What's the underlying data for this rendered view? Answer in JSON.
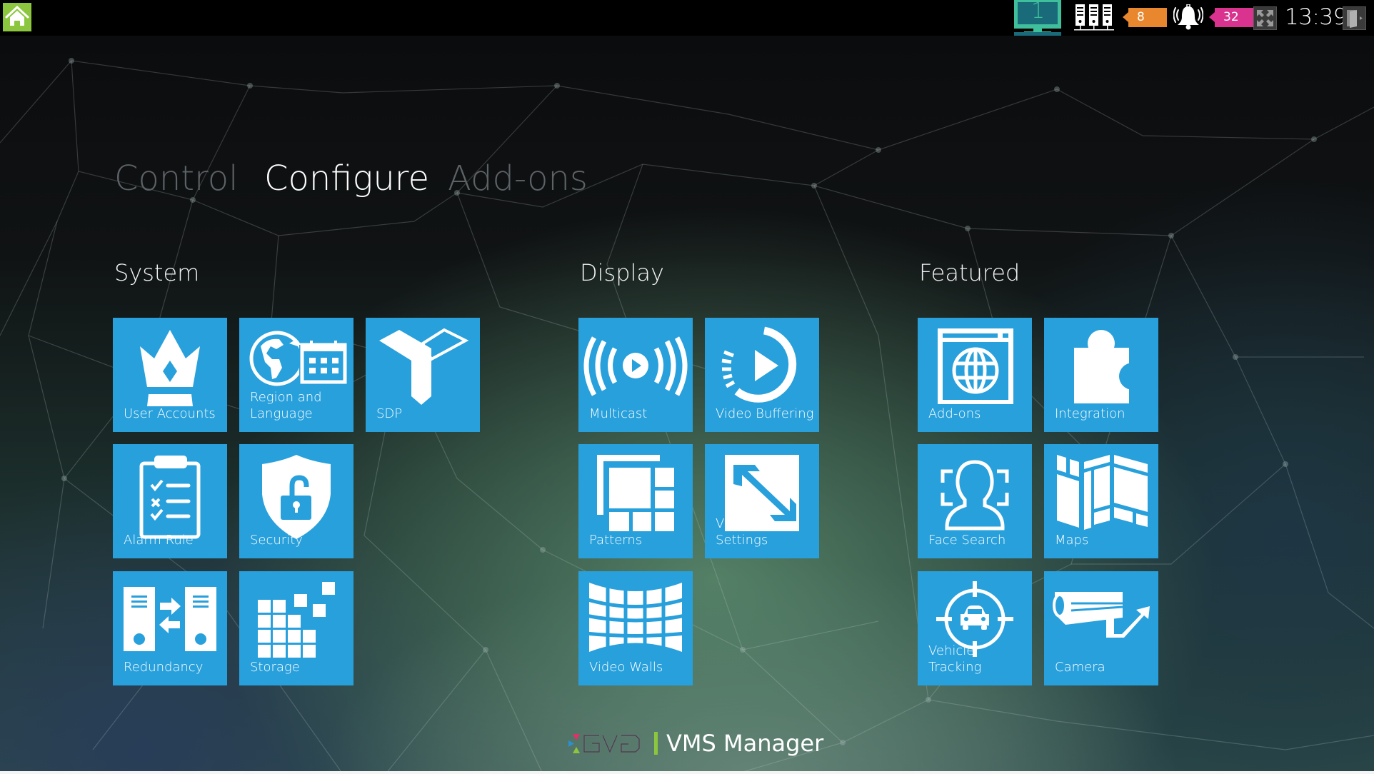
{
  "topbar": {
    "home_icon": "home-icon",
    "monitor_number": "1",
    "server_count": "8",
    "alarm_count": "32",
    "time": "13:39",
    "colors": {
      "home": "#8cc63f",
      "monitor": "#3fbf9b",
      "server_badge": "#e8872d",
      "alarm_badge": "#d9338f"
    }
  },
  "tabs": [
    {
      "label": "Control",
      "active": false
    },
    {
      "label": "Configure",
      "active": true
    },
    {
      "label": "Add-ons",
      "active": false
    }
  ],
  "sections": [
    {
      "title": "System",
      "tiles": [
        {
          "label": "User Accounts",
          "icon": "crown-icon"
        },
        {
          "label": "Region and Language",
          "icon": "globe-calendar-icon"
        },
        {
          "label": "SDP",
          "icon": "sdp-icon"
        },
        {
          "label": "Alarm Rule",
          "icon": "clipboard-checklist-icon"
        },
        {
          "label": "Security",
          "icon": "shield-lock-icon"
        },
        {
          "label": "Redundancy",
          "icon": "server-sync-icon"
        },
        {
          "label": "Storage",
          "icon": "storage-blocks-icon"
        }
      ]
    },
    {
      "title": "Display",
      "tiles": [
        {
          "label": "Multicast",
          "icon": "broadcast-icon"
        },
        {
          "label": "Video Buffering",
          "icon": "buffer-play-icon"
        },
        {
          "label": "Patterns",
          "icon": "layout-pattern-icon"
        },
        {
          "label": "Viewer Settings",
          "icon": "resize-arrow-icon"
        },
        {
          "label": "Video Walls",
          "icon": "video-wall-icon"
        }
      ]
    },
    {
      "title": "Featured",
      "tiles": [
        {
          "label": "Add-ons",
          "icon": "browser-globe-icon"
        },
        {
          "label": "Integration",
          "icon": "puzzle-icon"
        },
        {
          "label": "Face Search",
          "icon": "face-scan-icon"
        },
        {
          "label": "Maps",
          "icon": "map-icon"
        },
        {
          "label": "Vehicle Tracking",
          "icon": "vehicle-target-icon"
        },
        {
          "label": "Camera",
          "icon": "cctv-camera-icon"
        }
      ]
    }
  ],
  "footer": {
    "brand": "GVD",
    "product": "VMS Manager"
  },
  "theme": {
    "tile_color": "#28a0dc",
    "accent_green": "#8cc63f"
  }
}
